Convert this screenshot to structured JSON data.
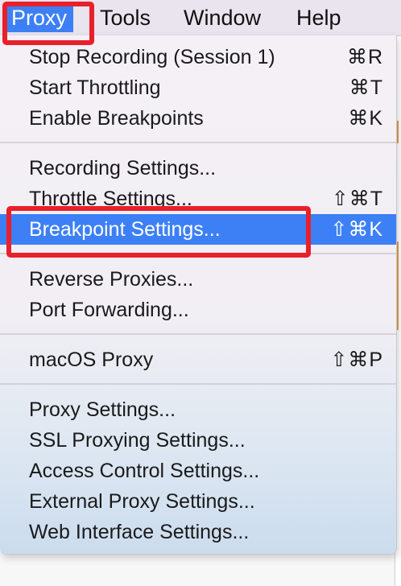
{
  "menubar": {
    "items": [
      {
        "label": "Proxy",
        "active": true
      },
      {
        "label": "Tools"
      },
      {
        "label": "Window"
      },
      {
        "label": "Help"
      }
    ]
  },
  "menu": {
    "items": [
      {
        "label": "Stop Recording (Session 1)",
        "shortcut": "⌘R"
      },
      {
        "label": "Start Throttling",
        "shortcut": "⌘T"
      },
      {
        "label": "Enable Breakpoints",
        "shortcut": "⌘K"
      },
      {
        "label": "Recording Settings..."
      },
      {
        "label": "Throttle Settings...",
        "shortcut": "⇧⌘T"
      },
      {
        "label": "Breakpoint Settings...",
        "shortcut": "⇧⌘K",
        "highlighted": true
      },
      {
        "label": "Reverse Proxies..."
      },
      {
        "label": "Port Forwarding..."
      },
      {
        "label": "macOS Proxy",
        "shortcut": "⇧⌘P"
      },
      {
        "label": "Proxy Settings..."
      },
      {
        "label": "SSL Proxying Settings..."
      },
      {
        "label": "Access Control Settings..."
      },
      {
        "label": "External Proxy Settings..."
      },
      {
        "label": "Web Interface Settings..."
      }
    ]
  },
  "colors": {
    "highlight": "#3d80f6",
    "annotation": "#e8202a"
  }
}
